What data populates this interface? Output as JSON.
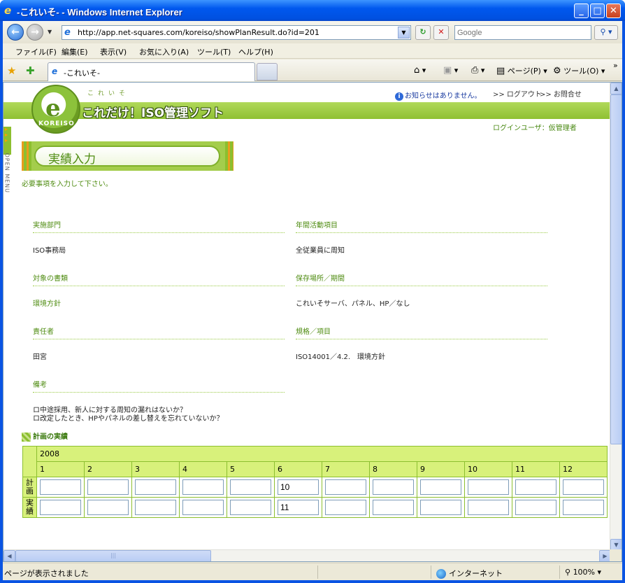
{
  "window": {
    "title": "-これいそ- - Windows Internet Explorer",
    "min": "_",
    "max": "□",
    "close": "✕"
  },
  "addressbar": {
    "url": "http://app.net-squares.com/koreiso/showPlanResult.do?id=201",
    "search_placeholder": "Google"
  },
  "menubar": [
    "ファイル(F)",
    "編集(E)",
    "表示(V)",
    "お気に入り(A)",
    "ツール(T)",
    "ヘルプ(H)"
  ],
  "tab": {
    "label": "-これいそ-"
  },
  "commandbar": {
    "page": "ページ(P)",
    "tools": "ツール(O)"
  },
  "header": {
    "brand_small": "これいそ",
    "brand": "これだけ！ISO管理ソフト",
    "logo_text": "KOREISO",
    "notice": "お知らせはありません。",
    "logout": ">> ログアウト",
    "contact": ">> お問合せ",
    "login_user": "ログインユーザ：仮管理者",
    "open_menu": "OPEN MENU"
  },
  "page": {
    "title": "実績入力",
    "required_note": "必要事項を入力して下さい。"
  },
  "fields": {
    "dept_label": "実施部門",
    "dept_value": "ISO事務局",
    "activity_label": "年間活動項目",
    "activity_value": "全従業員に周知",
    "doc_label": "対象の書類",
    "doc_value": "環境方針",
    "storage_label": "保存場所／期間",
    "storage_value": "これいそサーバ、パネル、HP／なし",
    "owner_label": "責任者",
    "owner_value": "田宮",
    "standard_label": "規格／項目",
    "standard_value": "ISO14001／4.2.　環境方針",
    "note_label": "備考",
    "note_line1": "ロ中途採用、新人に対する周知の漏れはないか？",
    "note_line2": "ロ改定したとき、HPやパネルの差し替えを忘れていないか？"
  },
  "plan": {
    "title": "計画の実績",
    "year": "2008",
    "months": [
      "1",
      "2",
      "3",
      "4",
      "5",
      "6",
      "7",
      "8",
      "9",
      "10",
      "11",
      "12"
    ],
    "plan_row_label": "計画",
    "result_row_label": "実績",
    "plan_values": [
      "",
      "",
      "",
      "",
      "",
      "10",
      "",
      "",
      "",
      "",
      "",
      ""
    ],
    "result_values": [
      "",
      "",
      "",
      "",
      "",
      "11",
      "",
      "",
      "",
      "",
      "",
      ""
    ]
  },
  "statusbar": {
    "status": "ページが表示されました",
    "zone": "インターネット",
    "zoom": "100%"
  }
}
